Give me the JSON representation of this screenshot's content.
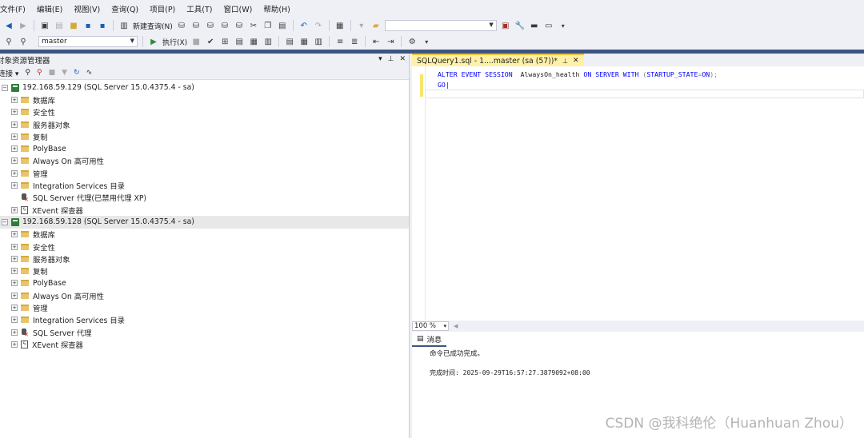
{
  "menu": [
    "文件(F)",
    "编辑(E)",
    "视图(V)",
    "查询(Q)",
    "项目(P)",
    "工具(T)",
    "窗口(W)",
    "帮助(H)"
  ],
  "toolbar": {
    "new_query_label": "新建查询(N)",
    "database": "master",
    "execute_label": "执行(X)"
  },
  "object_explorer": {
    "title": "对象资源管理器",
    "connect_label": "连接",
    "servers": [
      {
        "name": "192.168.59.129 (SQL Server 15.0.4375.4 - sa)",
        "children": [
          "数据库",
          "安全性",
          "服务器对象",
          "复制",
          "PolyBase",
          "Always On 高可用性",
          "管理",
          "Integration Services 目录"
        ],
        "agent": "SQL Server 代理(已禁用代理 XP)",
        "xevent": "XEvent 探查器"
      },
      {
        "name": "192.168.59.128 (SQL Server 15.0.4375.4 - sa)",
        "children": [
          "数据库",
          "安全性",
          "服务器对象",
          "复制",
          "PolyBase",
          "Always On 高可用性",
          "管理",
          "Integration Services 目录"
        ],
        "agent": "SQL Server 代理",
        "xevent": "XEvent 探查器"
      }
    ]
  },
  "document": {
    "tab_title": "SQLQuery1.sql - 1....master (sa (57))*",
    "code": {
      "l1_kw1": "ALTER EVENT SESSION",
      "l1_name": "AlwaysOn_health",
      "l1_kw2": "ON SERVER WITH",
      "l1_open": "(",
      "l1_opt": "STARTUP_STATE",
      "l1_eq": "=",
      "l1_val": "ON",
      "l1_close": ");",
      "l2": "GO"
    },
    "zoom": "100 %",
    "results_tab": "消息",
    "message": "命令已成功完成。",
    "completion_label": "完成时间: 2025-09-29T16:57:27.3879092+08:00"
  },
  "watermark": "CSDN @我科绝伦（Huanhuan Zhou）"
}
